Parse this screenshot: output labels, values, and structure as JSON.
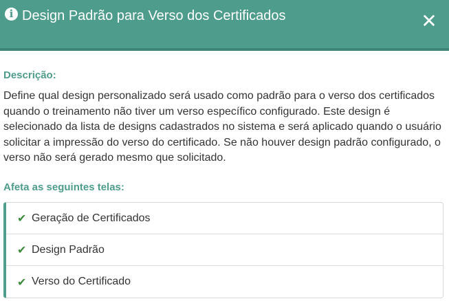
{
  "dialog": {
    "title": "Design Padrão para Verso dos Certificados",
    "info_icon": "i",
    "close_icon": "✕"
  },
  "description": {
    "label": "Descrição:",
    "text": "Define qual design personalizado será usado como padrão para o verso dos certificados quando o treinamento não tiver um verso específico configurado. Este design é selecionado da lista de designs cadastrados no sistema e será aplicado quando o usuário solicitar a impressão do verso do certificado. Se não houver design padrão configurado, o verso não será gerado mesmo que solicitado."
  },
  "affects": {
    "label": "Afeta as seguintes telas:",
    "items": [
      {
        "icon": "check-icon",
        "label": "Geração de Certificados"
      },
      {
        "icon": "check-icon",
        "label": "Design Padrão"
      },
      {
        "icon": "check-icon",
        "label": "Verso do Certificado"
      }
    ]
  },
  "colors": {
    "header": "#4e9c8b",
    "accent": "#4e9c8b",
    "check": "#3b8a3a"
  }
}
